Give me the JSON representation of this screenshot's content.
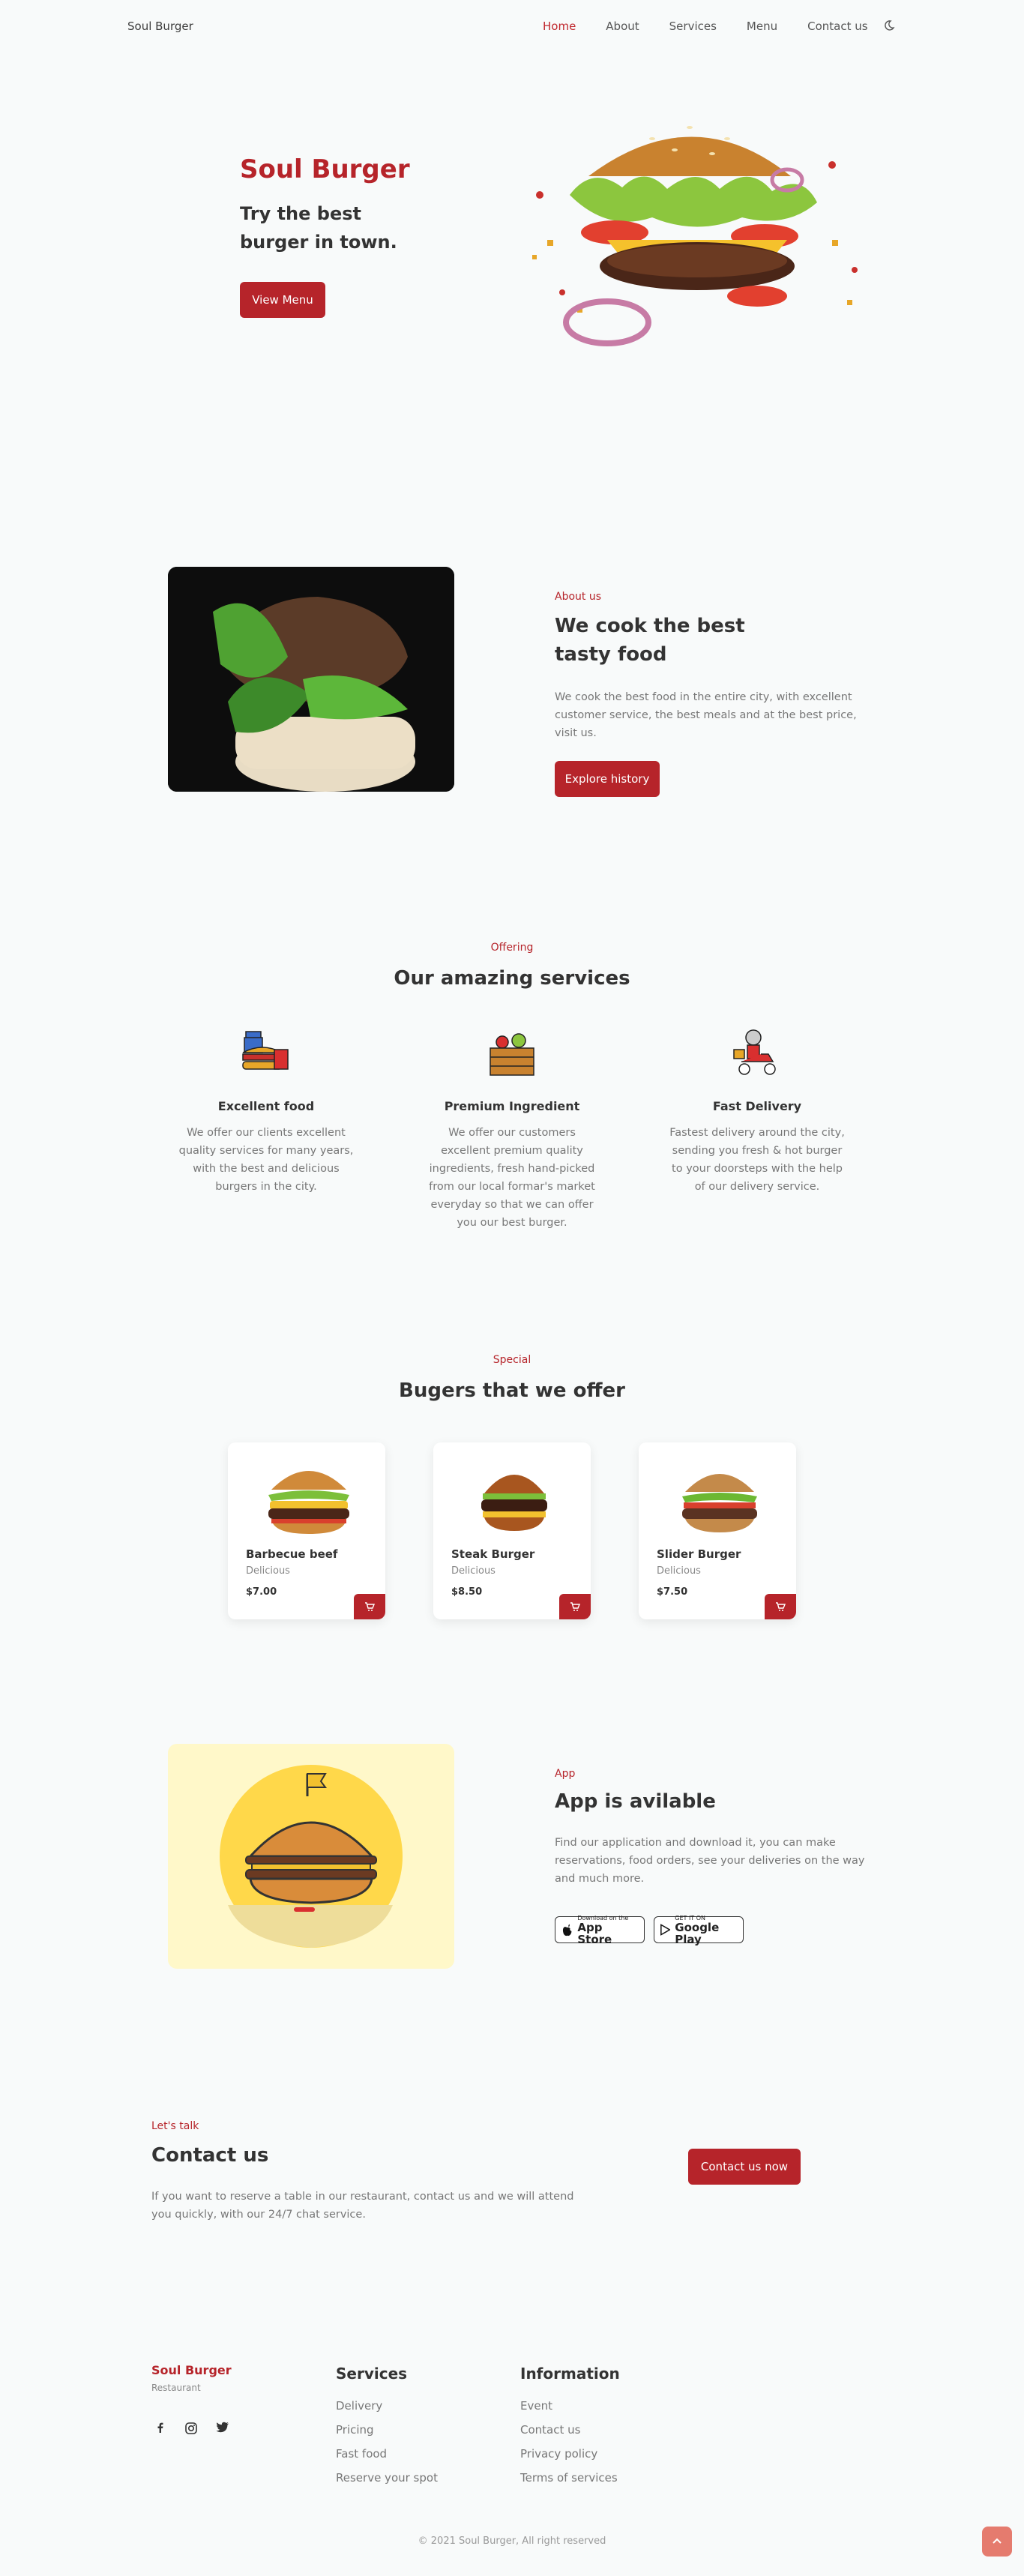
{
  "header": {
    "logo": "Soul Burger",
    "nav": [
      "Home",
      "About",
      "Services",
      "Menu",
      "Contact us"
    ],
    "active": "Home"
  },
  "hero": {
    "title": "Soul Burger",
    "subtitle": "Try the best burger in town.",
    "button": "View Menu"
  },
  "about": {
    "tag": "About us",
    "heading": "We cook the best tasty food",
    "text": "We cook the best food in the entire city, with excellent customer service, the best meals and at the best price, visit us.",
    "button": "Explore history"
  },
  "services": {
    "tag": "Offering",
    "heading": "Our amazing services",
    "items": [
      {
        "title": "Excellent food",
        "text": "We offer our clients excellent quality services for many years, with the best and delicious burgers in the city."
      },
      {
        "title": "Premium Ingredient",
        "text": "We offer our customers excellent premium quality ingredients, fresh hand-picked from our local formar's market everyday so that we can offer you our best burger."
      },
      {
        "title": "Fast Delivery",
        "text": "Fastest delivery around the city, sending you fresh & hot burger to your doorsteps with the help of our delivery service."
      }
    ]
  },
  "burgers": {
    "tag": "Special",
    "heading": "Bugers that we offer",
    "items": [
      {
        "name": "Barbecue beef",
        "desc": "Delicious",
        "price": "$7.00"
      },
      {
        "name": "Steak Burger",
        "desc": "Delicious",
        "price": "$8.50"
      },
      {
        "name": "Slider Burger",
        "desc": "Delicious",
        "price": "$7.50"
      }
    ]
  },
  "app": {
    "tag": "App",
    "heading": "App is avilable",
    "text": "Find our application and download it, you can make reservations, food orders, see your deliveries on the way and much more.",
    "appstore_small": "Download on the",
    "appstore_big": "App Store",
    "googleplay_small": "GET IT ON",
    "googleplay_big": "Google Play"
  },
  "contact": {
    "tag": "Let's talk",
    "heading": "Contact us",
    "text": "If you want to reserve a table in our restaurant, contact us and we will attend you quickly, with our 24/7 chat service.",
    "button": "Contact us now"
  },
  "footer": {
    "brand": "Soul Burger",
    "brand_sub": "Restaurant",
    "services_title": "Services",
    "services_links": [
      "Delivery",
      "Pricing",
      "Fast food",
      "Reserve your spot"
    ],
    "info_title": "Information",
    "info_links": [
      "Event",
      "Contact us",
      "Privacy policy",
      "Terms of services"
    ],
    "copyright": "© 2021 Soul Burger, All right reserved"
  },
  "icons": {
    "theme": "moon-icon",
    "cart": "cart-icon",
    "socials": [
      "facebook-icon",
      "instagram-icon",
      "twitter-icon"
    ],
    "scroll_top": "arrow-up-icon"
  },
  "colors": {
    "accent": "#b6242a",
    "background": "#f8fafa",
    "app_bg": "#fff8c9",
    "scroll_btn": "#e57b6e"
  }
}
